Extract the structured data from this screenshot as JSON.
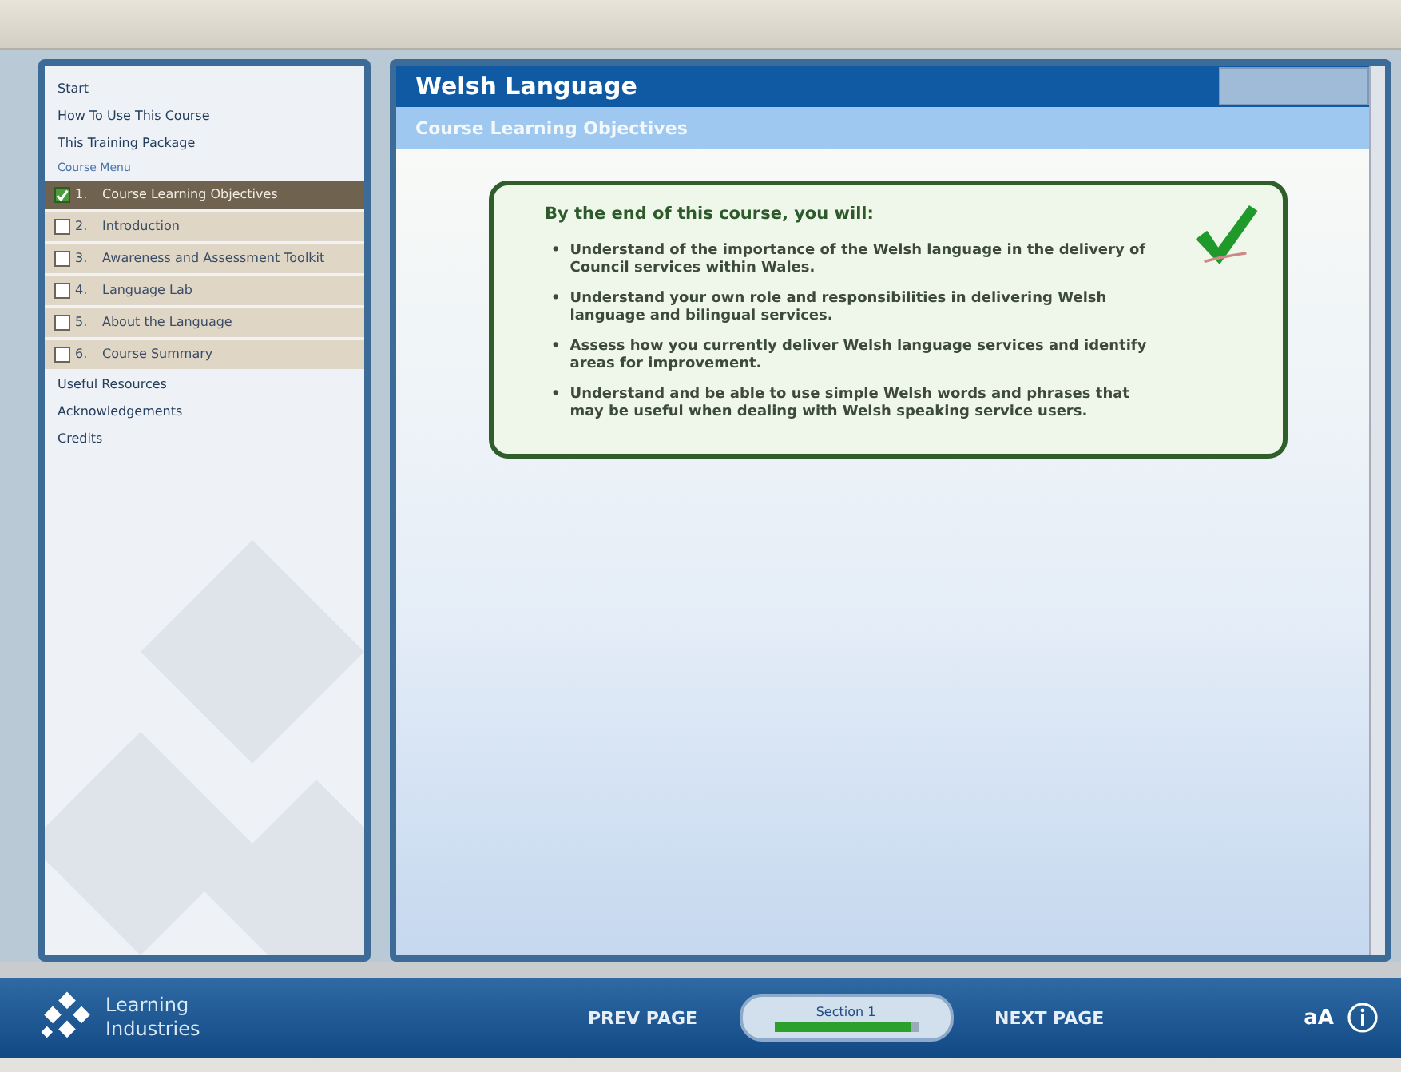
{
  "sidebar": {
    "links_top": [
      "Start",
      "How To Use This Course",
      "This Training Package"
    ],
    "menu_heading": "Course Menu",
    "menu_items": [
      {
        "number": "1.",
        "label": "Course Learning Objectives",
        "selected": true,
        "checked": true
      },
      {
        "number": "2.",
        "label": "Introduction",
        "selected": false,
        "checked": false
      },
      {
        "number": "3.",
        "label": "Awareness and Assessment Toolkit",
        "selected": false,
        "checked": false
      },
      {
        "number": "4.",
        "label": "Language Lab",
        "selected": false,
        "checked": false
      },
      {
        "number": "5.",
        "label": "About the Language",
        "selected": false,
        "checked": false
      },
      {
        "number": "6.",
        "label": "Course Summary",
        "selected": false,
        "checked": false
      }
    ],
    "links_bottom": [
      "Useful Resources",
      "Acknowledgements",
      "Credits"
    ]
  },
  "header": {
    "title": "Welsh Language",
    "subtitle": "Course Learning Objectives"
  },
  "objectives": {
    "intro": "By the end of this course, you will:",
    "bullet": "•",
    "items": [
      "Understand of the importance of the Welsh language in the delivery of Council services within Wales.",
      "Understand your own role and responsibilities in delivering Welsh language and bilingual services.",
      "Assess how you currently deliver Welsh language services and identify areas for improvement.",
      "Understand and be able to use simple Welsh words and phrases that may be useful when dealing with Welsh speaking service users."
    ]
  },
  "footer": {
    "logo": [
      "Learning",
      "Industries"
    ],
    "prev": "PREV PAGE",
    "next": "NEXT PAGE",
    "section": {
      "label": "Section 1",
      "level": 0.95
    },
    "font_size": "aA"
  }
}
